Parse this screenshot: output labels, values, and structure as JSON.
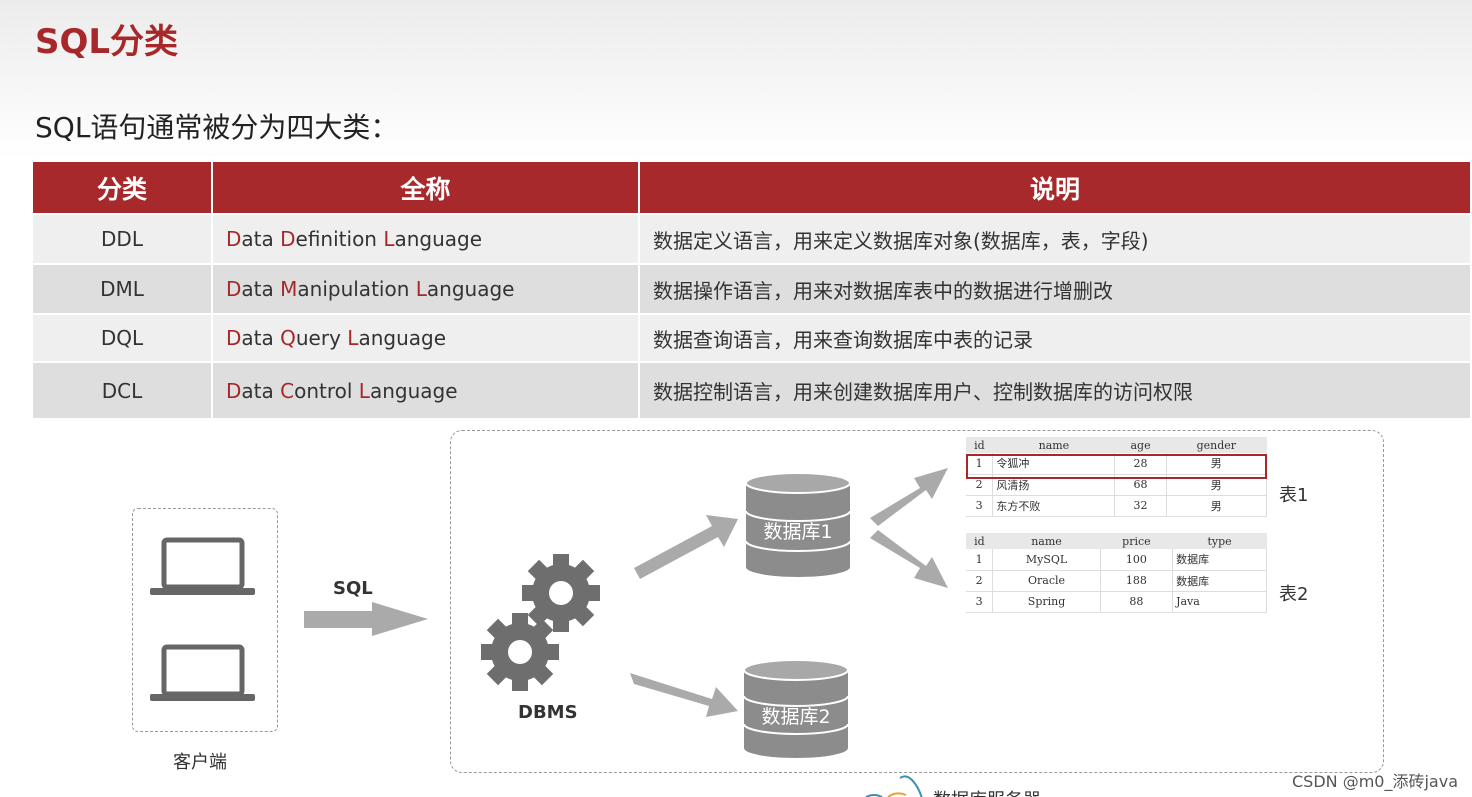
{
  "slide": {
    "title": "SQL分类",
    "subtitle": "SQL语句通常被分为四大类："
  },
  "table": {
    "headers": [
      "分类",
      "全称",
      "说明"
    ],
    "rows": [
      {
        "code": "DDL",
        "full": [
          [
            "D",
            "ata "
          ],
          [
            "D",
            "efinition "
          ],
          [
            "L",
            "anguage"
          ]
        ],
        "desc": "数据定义语言，用来定义数据库对象(数据库，表，字段)"
      },
      {
        "code": "DML",
        "full": [
          [
            "D",
            "ata "
          ],
          [
            "M",
            "anipulation "
          ],
          [
            "L",
            "anguage"
          ]
        ],
        "desc": "数据操作语言，用来对数据库表中的数据进行增删改"
      },
      {
        "code": "DQL",
        "full": [
          [
            "D",
            "ata "
          ],
          [
            "Q",
            "uery "
          ],
          [
            "L",
            "anguage"
          ]
        ],
        "desc": "数据查询语言，用来查询数据库中表的记录"
      },
      {
        "code": "DCL",
        "full": [
          [
            "D",
            "ata "
          ],
          [
            "C",
            "ontrol "
          ],
          [
            "L",
            "anguage"
          ]
        ],
        "desc": "数据控制语言，用来创建数据库用户、控制数据库的访问权限"
      }
    ],
    "highlight_color": "#a8282a",
    "header_color": "#a8292b"
  },
  "diagram": {
    "client_label": "客户端",
    "sql_label": "SQL",
    "dbms_label": "DBMS",
    "db1_label": "数据库1",
    "db2_label": "数据库2",
    "table1_label": "表1",
    "table2_label": "表2",
    "server_label": "数据库服务器",
    "icons": [
      "laptop-icon",
      "laptop-icon",
      "gear-icon",
      "gear-icon",
      "database-icon",
      "database-icon",
      "mysql-dolphin-icon"
    ],
    "table1": {
      "headers": [
        "id",
        "name",
        "age",
        "gender"
      ],
      "rows": [
        [
          "1",
          "令狐冲",
          "28",
          "男"
        ],
        [
          "2",
          "风清扬",
          "68",
          "男"
        ],
        [
          "3",
          "东方不败",
          "32",
          "男"
        ]
      ]
    },
    "table2": {
      "headers": [
        "id",
        "name",
        "price",
        "type"
      ],
      "rows": [
        [
          "1",
          "MySQL",
          "100",
          "数据库"
        ],
        [
          "2",
          "Oracle",
          "188",
          "数据库"
        ],
        [
          "3",
          "Spring",
          "88",
          "Java"
        ]
      ]
    }
  },
  "watermark": "CSDN @m0_添砖java"
}
